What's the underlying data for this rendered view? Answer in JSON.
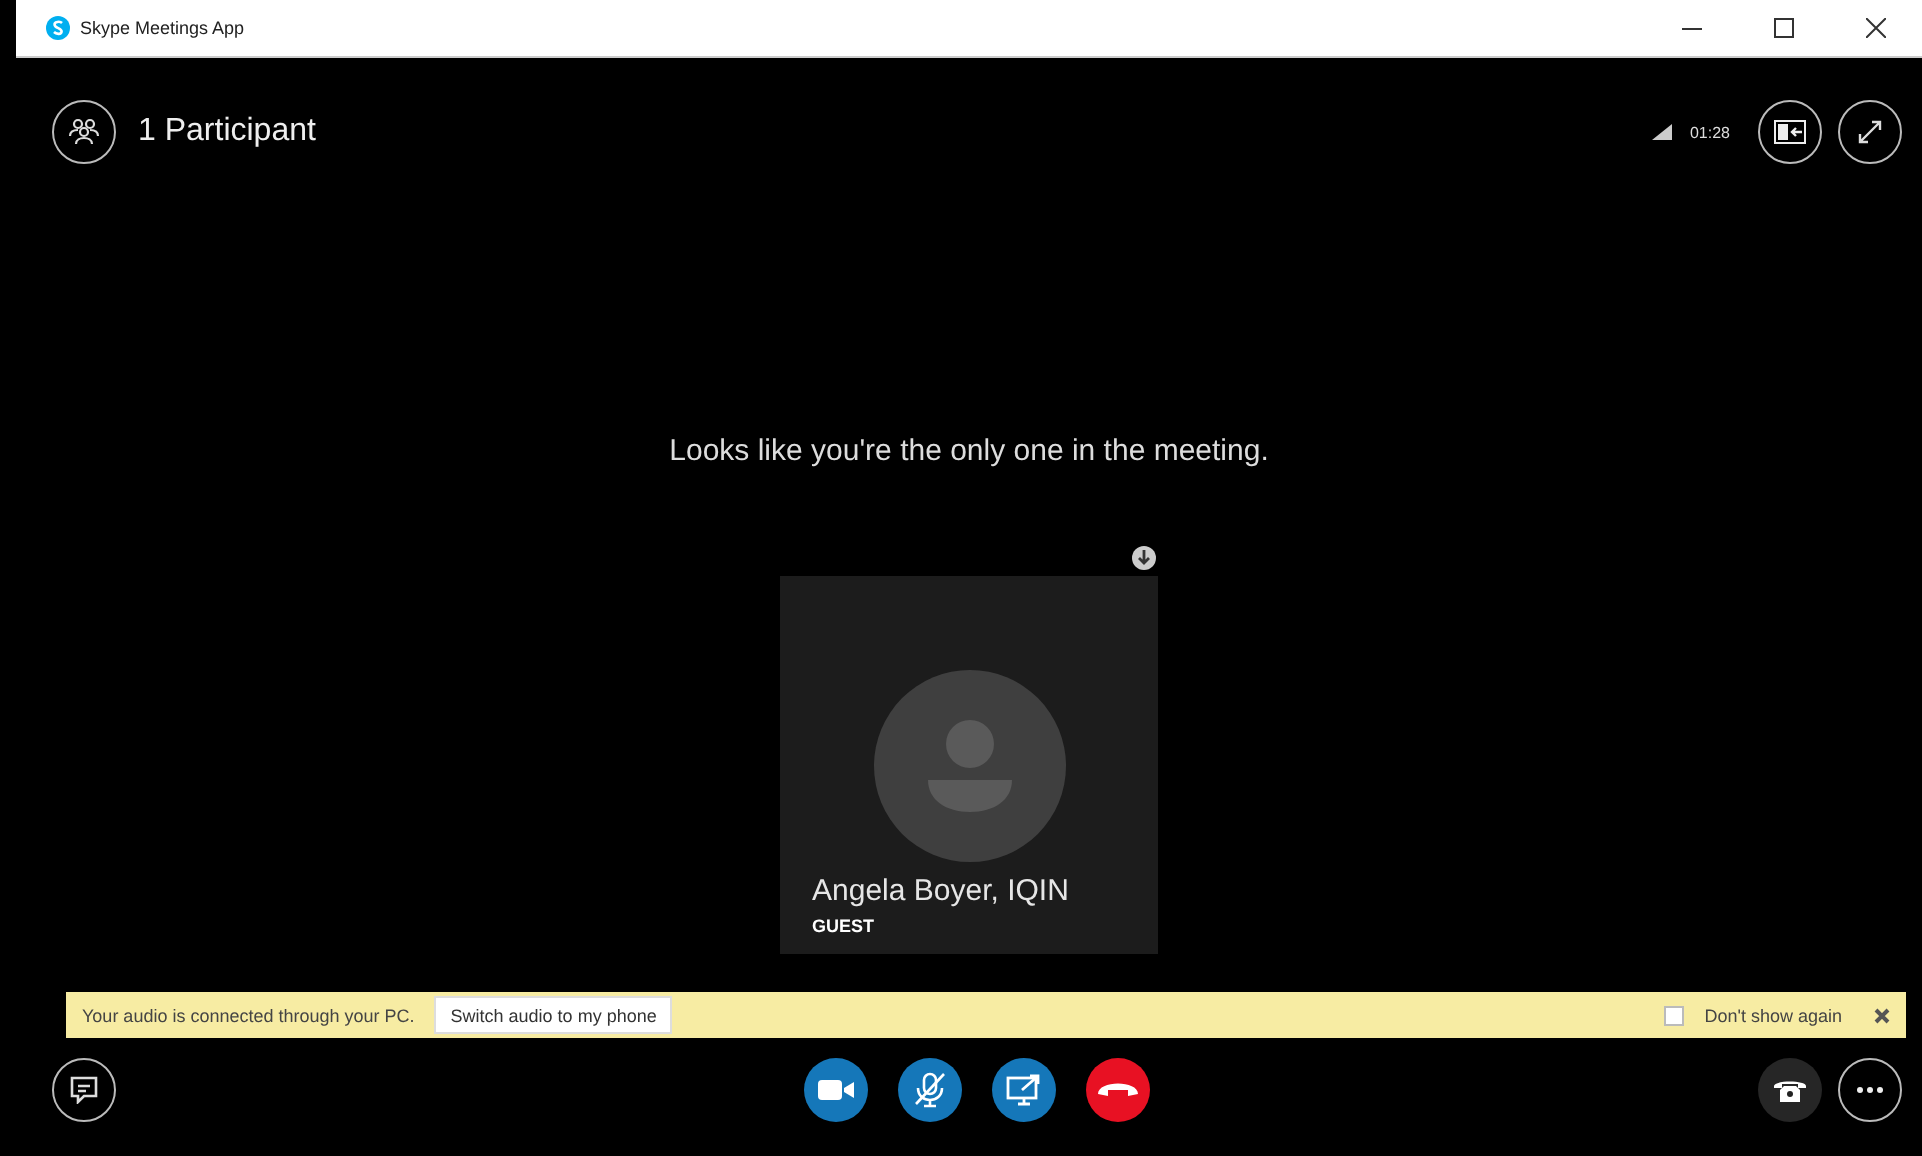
{
  "window": {
    "title": "Skype Meetings App"
  },
  "header": {
    "participants": "1 Participant",
    "call_time": "01:28"
  },
  "message": "Looks like you're the only one in the meeting.",
  "participant": {
    "name": "Angela Boyer, IQIN",
    "role": "GUEST"
  },
  "banner": {
    "text": "Your audio is connected through your PC.",
    "action": "Switch audio to my phone",
    "dont_show": {
      "label": "Don't show again",
      "checked": false
    }
  },
  "controls": [
    {
      "kind": "video"
    },
    {
      "kind": "mic",
      "muted": true
    },
    {
      "kind": "share"
    },
    {
      "kind": "hangup"
    }
  ]
}
